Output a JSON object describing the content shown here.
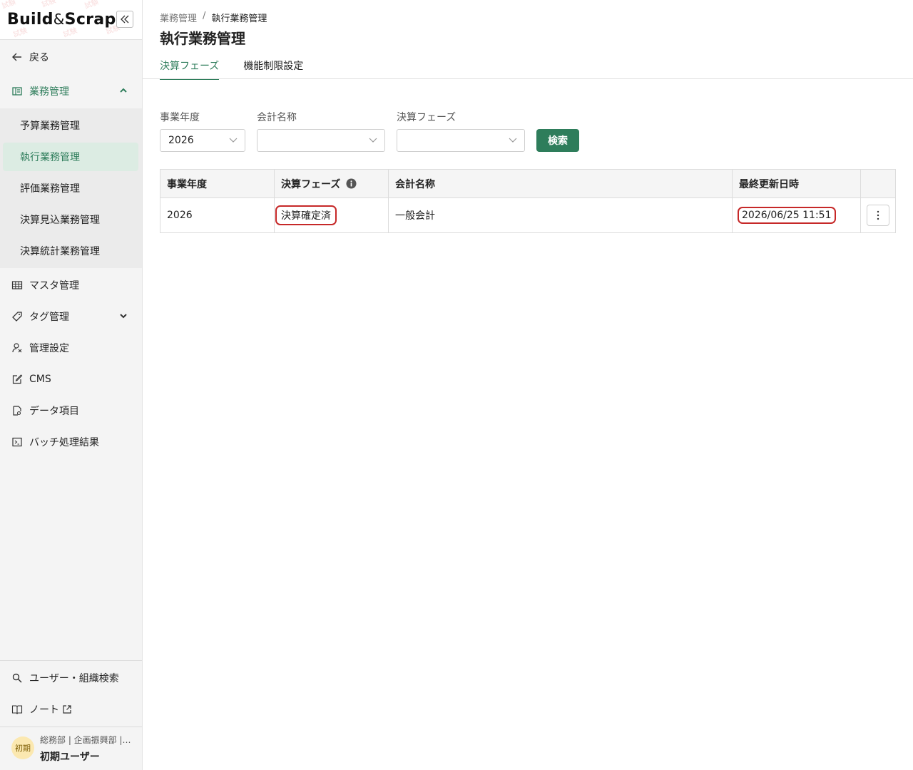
{
  "sidebar": {
    "logo": {
      "build": "Build",
      "amp": "&",
      "scrap": "Scrap"
    },
    "back_label": "戻る",
    "business": {
      "label": "業務管理",
      "subitems": [
        "予算業務管理",
        "執行業務管理",
        "評価業務管理",
        "決算見込業務管理",
        "決算統計業務管理"
      ]
    },
    "items": [
      "マスタ管理",
      "タグ管理",
      "管理設定",
      "CMS",
      "データ項目",
      "バッチ処理結果"
    ],
    "bottom_items": [
      "ユーザー・組織検索",
      "ノート"
    ],
    "user": {
      "avatar": "初期",
      "dept": "総務部 | 企画振興部 | …",
      "name": "初期ユーザー"
    }
  },
  "breadcrumb": {
    "parent": "業務管理",
    "separator": "/",
    "current": "執行業務管理"
  },
  "page_title": "執行業務管理",
  "tabs": [
    "決算フェーズ",
    "機能制限設定"
  ],
  "filters": {
    "year_label": "事業年度",
    "year_value": "2026",
    "account_label": "会計名称",
    "account_value": "",
    "phase_label": "決算フェーズ",
    "phase_value": ""
  },
  "search_button": "検索",
  "table": {
    "headers": [
      "事業年度",
      "決算フェーズ",
      "会計名称",
      "最終更新日時"
    ],
    "rows": [
      {
        "year": "2026",
        "phase": "決算確定済",
        "account": "一般会計",
        "updated": "2026/06/25 11:51"
      }
    ]
  },
  "colors": {
    "accent": "#2e7d5b",
    "highlight": "#c62828"
  }
}
